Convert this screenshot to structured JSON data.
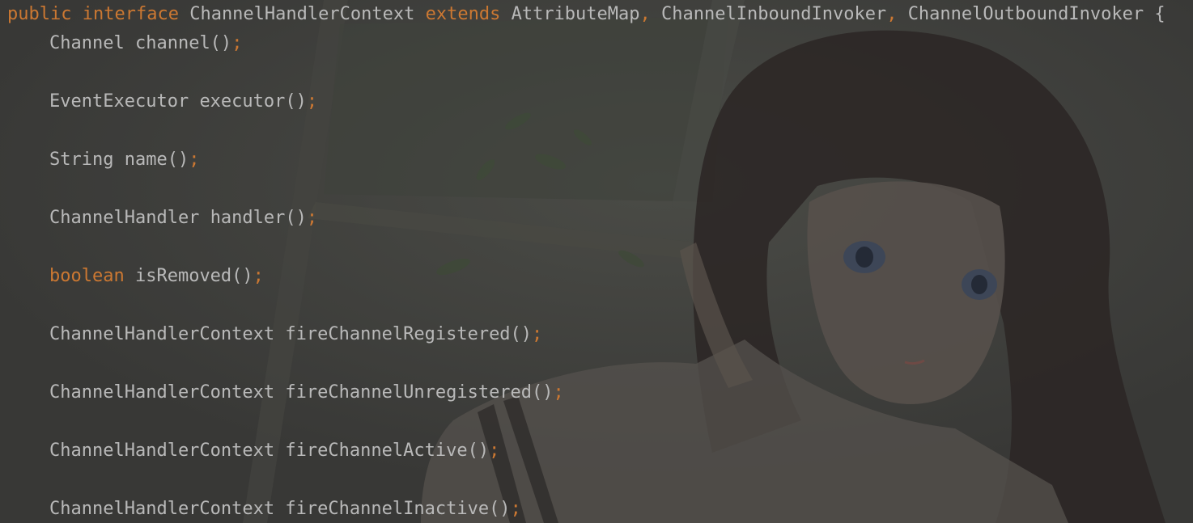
{
  "colors": {
    "background": "#3b3b39",
    "keyword": "#cc7832",
    "text": "#b9b9b9"
  },
  "background_image": "anime-girl-wallpaper",
  "header": {
    "kw_public": "public",
    "kw_interface": "interface",
    "type_name": "ChannelHandlerContext",
    "kw_extends": "extends",
    "parent1": "AttributeMap",
    "comma1": ",",
    "parent2": "ChannelInboundInvoker",
    "comma2": ",",
    "parent3": "ChannelOutboundInvoker",
    "brace": "{"
  },
  "methods": [
    {
      "ret": "Channel",
      "keyword_ret": false,
      "name": "channel()",
      "end": ";"
    },
    {
      "ret": "EventExecutor",
      "keyword_ret": false,
      "name": "executor()",
      "end": ";"
    },
    {
      "ret": "String",
      "keyword_ret": false,
      "name": "name()",
      "end": ";"
    },
    {
      "ret": "ChannelHandler",
      "keyword_ret": false,
      "name": "handler()",
      "end": ";"
    },
    {
      "ret": "boolean",
      "keyword_ret": true,
      "name": "isRemoved()",
      "end": ";"
    },
    {
      "ret": "ChannelHandlerContext",
      "keyword_ret": false,
      "name": "fireChannelRegistered()",
      "end": ";"
    },
    {
      "ret": "ChannelHandlerContext",
      "keyword_ret": false,
      "name": "fireChannelUnregistered()",
      "end": ";"
    },
    {
      "ret": "ChannelHandlerContext",
      "keyword_ret": false,
      "name": "fireChannelActive()",
      "end": ";"
    },
    {
      "ret": "ChannelHandlerContext",
      "keyword_ret": false,
      "name": "fireChannelInactive()",
      "end": ";"
    }
  ]
}
